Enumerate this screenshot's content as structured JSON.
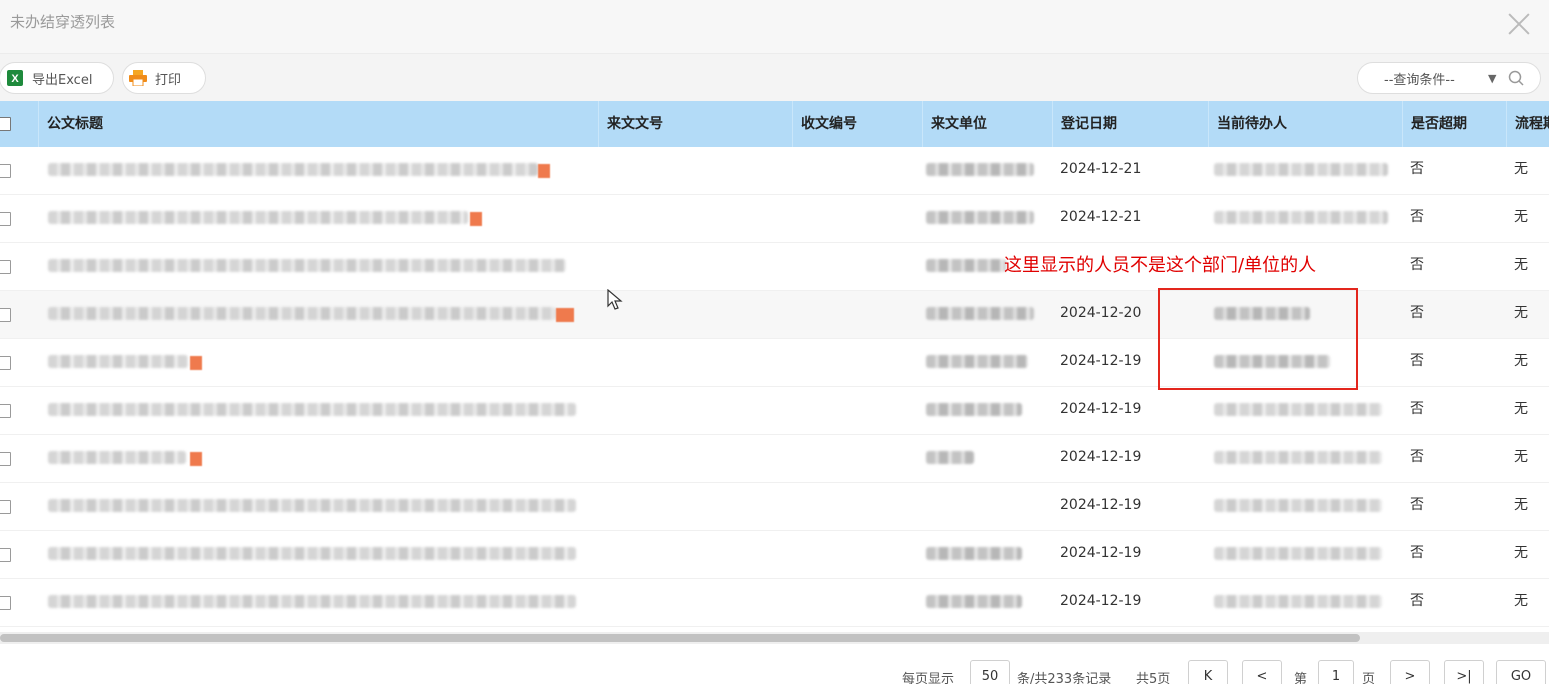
{
  "window": {
    "title": "未办结穿透列表"
  },
  "toolbar": {
    "export_label": "导出Excel",
    "print_label": "打印",
    "query": {
      "label": "--查询条件--"
    }
  },
  "table": {
    "columns": [
      "公文标题",
      "来文文号",
      "收文编号",
      "来文单位",
      "登记日期",
      "当前待办人",
      "是否超期",
      "流程期"
    ],
    "rows": [
      {
        "date": "2024-12-21",
        "overdue": "否",
        "flow": "无"
      },
      {
        "date": "2024-12-21",
        "overdue": "否",
        "flow": "无"
      },
      {
        "date": "",
        "overdue": "否",
        "flow": "无"
      },
      {
        "date": "2024-12-20",
        "overdue": "否",
        "flow": "无"
      },
      {
        "date": "2024-12-19",
        "overdue": "否",
        "flow": "无"
      },
      {
        "date": "2024-12-19",
        "overdue": "否",
        "flow": "无"
      },
      {
        "date": "2024-12-19",
        "overdue": "否",
        "flow": "无"
      },
      {
        "date": "2024-12-19",
        "overdue": "否",
        "flow": "无"
      },
      {
        "date": "2024-12-19",
        "overdue": "否",
        "flow": "无"
      },
      {
        "date": "2024-12-19",
        "overdue": "否",
        "flow": "无"
      }
    ]
  },
  "annotation": {
    "text": "这里显示的人员不是这个部门/单位的人",
    "color": "#e3261d"
  },
  "pagination": {
    "per_page_label": "每页显示",
    "per_page": "50",
    "total_label": "条/共233条记录",
    "pages_label": "共5页",
    "first": "K",
    "prev": "<",
    "page_prefix": "第",
    "page": "1",
    "page_suffix": "页",
    "next": ">",
    "last": ">|",
    "go": "GO"
  },
  "colors": {
    "header_bg": "#b3dbf7",
    "accent_red": "#e3261d",
    "mark_orange": "#ef7a4d"
  }
}
